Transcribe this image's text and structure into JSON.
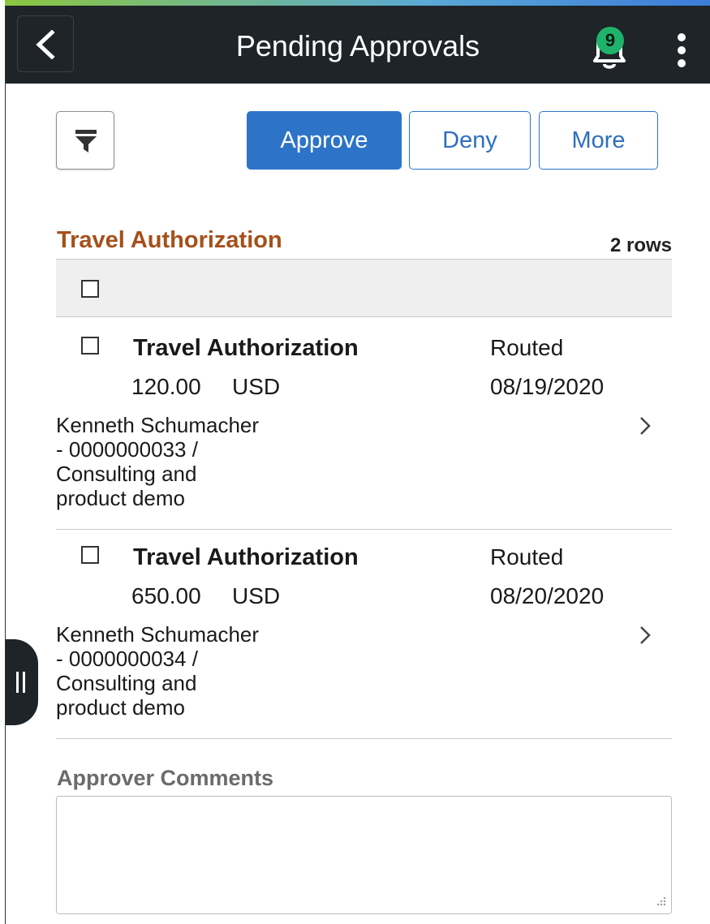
{
  "header": {
    "title": "Pending Approvals",
    "notification_count": "9",
    "back_icon": "chevron-left-icon",
    "menu_icon": "kebab-vertical-icon"
  },
  "toolbar": {
    "filter_icon": "filter-funnel-icon",
    "approve_label": "Approve",
    "deny_label": "Deny",
    "more_label": "More"
  },
  "section": {
    "title": "Travel Authorization",
    "row_count": "2 rows"
  },
  "items": [
    {
      "title": "Travel Authorization",
      "status": "Routed",
      "amount": "120.00",
      "currency": "USD",
      "date": "08/19/2020",
      "desc_line1": "Kenneth Schumacher",
      "desc_line2": "- 0000000033 /",
      "desc_line3": "Consulting and",
      "desc_line4": "product demo"
    },
    {
      "title": "Travel Authorization",
      "status": "Routed",
      "amount": "650.00",
      "currency": "USD",
      "date": "08/20/2020",
      "desc_line1": "Kenneth Schumacher",
      "desc_line2": "- 0000000034 /",
      "desc_line3": "Consulting and",
      "desc_line4": "product demo"
    }
  ],
  "comments": {
    "label": "Approver Comments",
    "value": ""
  },
  "colors": {
    "header_bg": "#1e2428",
    "primary": "#2d74c8",
    "section_title": "#a5501b",
    "badge": "#1fb26b"
  }
}
